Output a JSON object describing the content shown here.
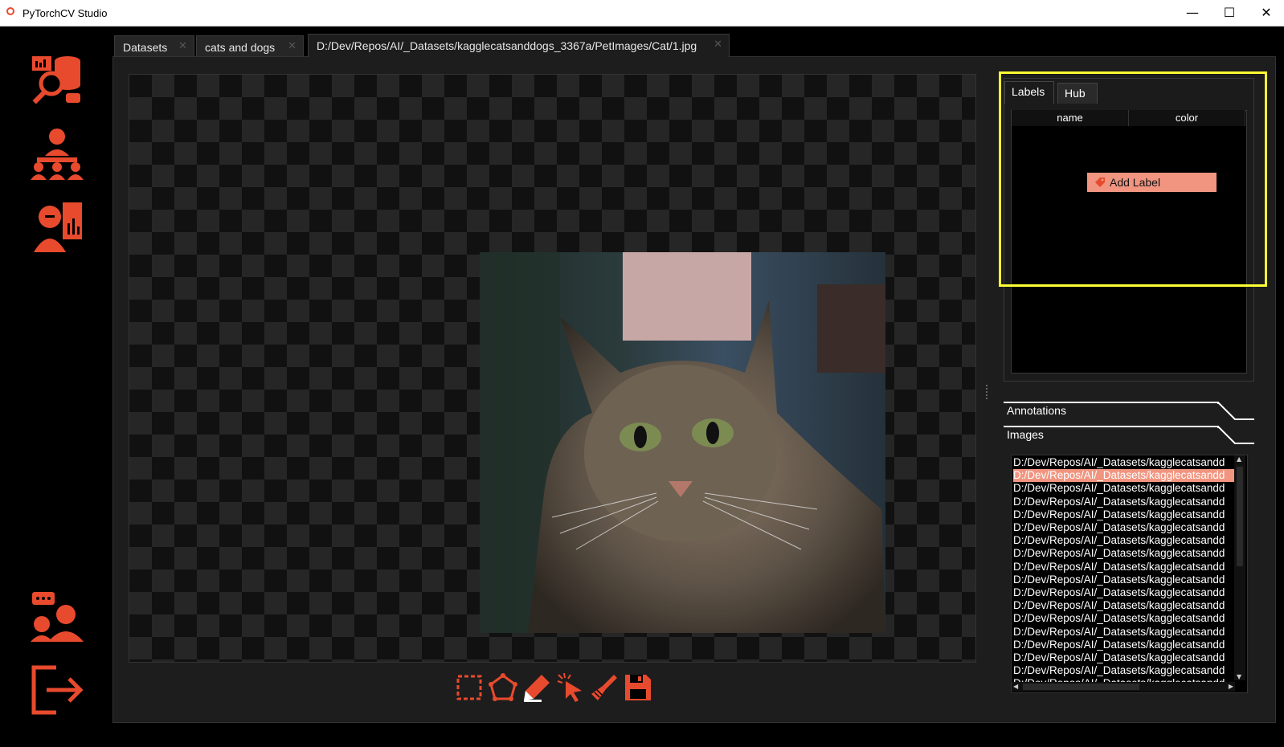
{
  "window": {
    "title": "PyTorchCV Studio",
    "minimize": "—",
    "maximize": "☐",
    "close": "✕"
  },
  "sidebar": {
    "accent": "#e84a2e",
    "items": [
      {
        "icon": "dataset-search-icon"
      },
      {
        "icon": "team-training-icon"
      },
      {
        "icon": "analytics-report-icon"
      },
      {
        "icon": "support-chat-icon"
      },
      {
        "icon": "logout-icon"
      }
    ]
  },
  "tabs": [
    {
      "label": "Datasets",
      "close": "✕"
    },
    {
      "label": "cats and dogs",
      "close": "✕"
    },
    {
      "label": "D:/Dev/Repos/AI/_Datasets/kagglecatsanddogs_3367a/PetImages/Cat/1.jpg",
      "close": "✕",
      "active": true
    }
  ],
  "toolbar": {
    "tools": [
      {
        "icon": "rectangle-select-icon"
      },
      {
        "icon": "polygon-icon"
      },
      {
        "icon": "pen-icon"
      },
      {
        "icon": "magic-click-icon"
      },
      {
        "icon": "brush-clear-icon"
      },
      {
        "icon": "save-icon"
      }
    ]
  },
  "labels_panel": {
    "tabs": [
      "Labels",
      "Hub"
    ],
    "columns": [
      "name",
      "color"
    ],
    "add_button": "Add Label",
    "button_color": "#f19580",
    "highlight_color": "#ffff33"
  },
  "sections": {
    "annotations": "Annotations",
    "images": "Images"
  },
  "images": {
    "selected_index": 1,
    "rows": [
      "D:/Dev/Repos/AI/_Datasets/kagglecatsandd",
      "D:/Dev/Repos/AI/_Datasets/kagglecatsandd",
      "D:/Dev/Repos/AI/_Datasets/kagglecatsandd",
      "D:/Dev/Repos/AI/_Datasets/kagglecatsandd",
      "D:/Dev/Repos/AI/_Datasets/kagglecatsandd",
      "D:/Dev/Repos/AI/_Datasets/kagglecatsandd",
      "D:/Dev/Repos/AI/_Datasets/kagglecatsandd",
      "D:/Dev/Repos/AI/_Datasets/kagglecatsandd",
      "D:/Dev/Repos/AI/_Datasets/kagglecatsandd",
      "D:/Dev/Repos/AI/_Datasets/kagglecatsandd",
      "D:/Dev/Repos/AI/_Datasets/kagglecatsandd",
      "D:/Dev/Repos/AI/_Datasets/kagglecatsandd",
      "D:/Dev/Repos/AI/_Datasets/kagglecatsandd",
      "D:/Dev/Repos/AI/_Datasets/kagglecatsandd",
      "D:/Dev/Repos/AI/_Datasets/kagglecatsandd",
      "D:/Dev/Repos/AI/_Datasets/kagglecatsandd",
      "D:/Dev/Repos/AI/_Datasets/kagglecatsandd",
      "D:/Dev/Repos/AI/_Datasets/kagglecatsandd"
    ]
  }
}
